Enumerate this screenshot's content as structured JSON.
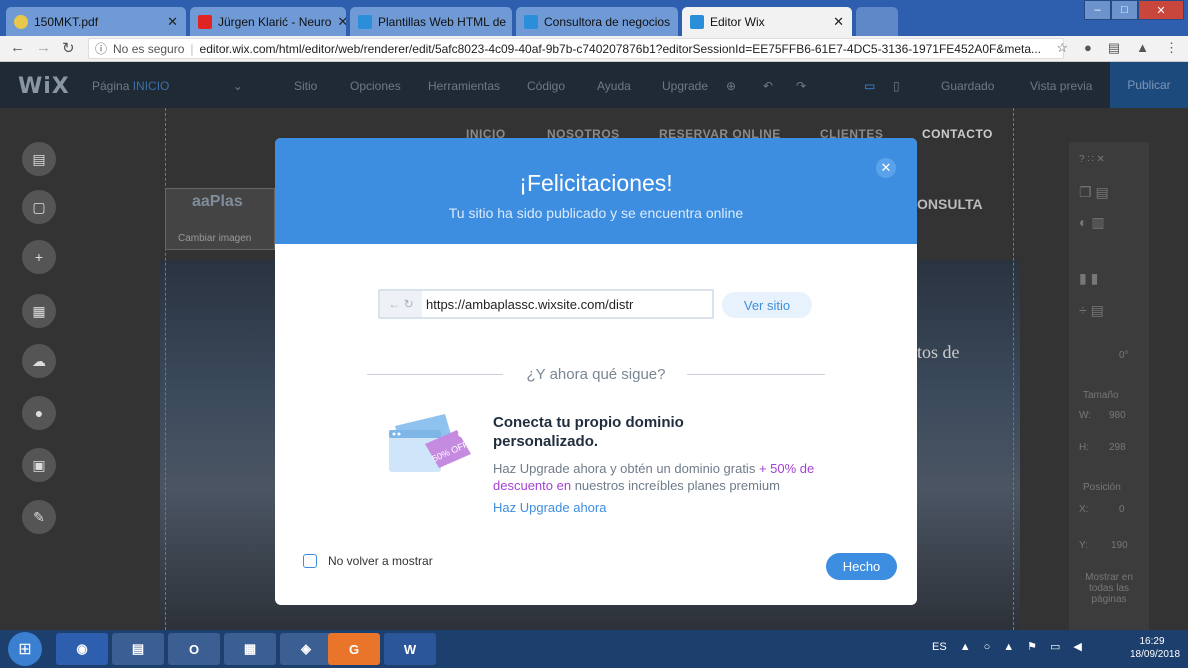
{
  "browser": {
    "tabs": [
      {
        "title": "150MKT.pdf"
      },
      {
        "title": "Jürgen Klarić - Neuro"
      },
      {
        "title": "Plantillas Web HTML de"
      },
      {
        "title": "Consultora de negocios"
      },
      {
        "title": "Editor Wix"
      }
    ],
    "security": "No es seguro",
    "url": "editor.wix.com/html/editor/web/renderer/edit/5afc8023-4c09-40af-9b7b-c740207876b1?editorSessionId=EE75FFB6-61E7-4DC5-3136-1971FE452A0F&meta..."
  },
  "wix": {
    "logo": "WiX",
    "page_label": "Página",
    "page_name": "INICIO",
    "menu": [
      "Sitio",
      "Opciones",
      "Herramientas",
      "Código",
      "Ayuda",
      "Upgrade"
    ],
    "saved": "Guardado",
    "preview": "Vista previa",
    "publish": "Publicar"
  },
  "site": {
    "nav": [
      "INICIO",
      "NOSOTROS",
      "RESERVAR ONLINE",
      "CLIENTES",
      "CONTACTO"
    ],
    "change_image": "Cambiar imagen",
    "consulta": "ONSULTA",
    "tos_de": "tos de"
  },
  "right_panel": {
    "size_label": "Tamaño",
    "w_label": "W:",
    "w_value": "980",
    "h_label": "H:",
    "h_value": "298",
    "pos_label": "Posición",
    "x_label": "X:",
    "x_value": "0",
    "y_label": "Y:",
    "y_value": "190",
    "angle": "0°",
    "show_all": "Mostrar en todas las páginas"
  },
  "modal": {
    "title": "¡Felicitaciones!",
    "subtitle": "Tu sitio ha sido publicado y se encuentra online",
    "site_url": "https://ambaplassc.wixsite.com/distr",
    "view_site": "Ver sitio",
    "next_title": "¿Y ahora qué sigue?",
    "promo_title": "Conecta tu propio dominio personalizado.",
    "promo_text_1": "Haz Upgrade ahora y obtén un dominio gratis ",
    "promo_text_hl": "+ 50% de descuento en",
    "promo_text_2": " nuestros increíbles planes premium",
    "promo_link": "Haz Upgrade ahora",
    "badge_text": "50% OFF",
    "card_text": "www",
    "dont_show": "No volver a mostrar",
    "done": "Hecho"
  },
  "taskbar": {
    "lang": "ES",
    "time": "16:29",
    "date": "18/09/2018"
  },
  "colors": {
    "modal_header": "#3d8ee0",
    "highlight": "#a442d6",
    "wix_bar": "#1f2a35"
  }
}
